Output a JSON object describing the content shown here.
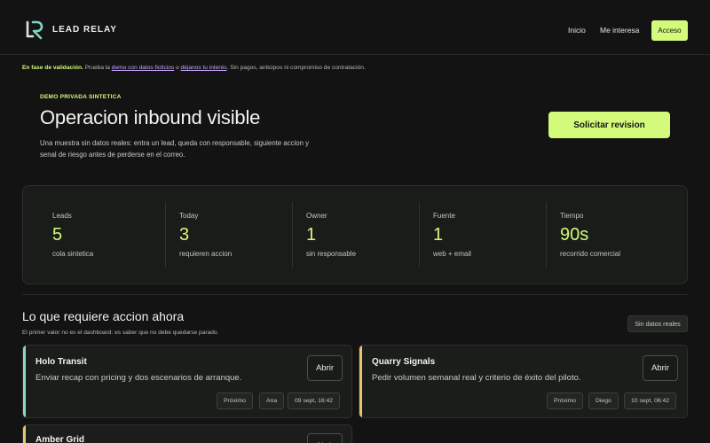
{
  "header": {
    "brand": "LEAD RELAY",
    "logo_icon": "lr-monogram-icon",
    "nav": [
      "Inicio",
      "Me interesa"
    ],
    "cta": "Acceso"
  },
  "notice": {
    "lead": "En fase de validación.",
    "t1": " Prueba la ",
    "link1": "demo con datos ficticios",
    "t2": " o ",
    "link2": "déjanos tu interés",
    "t3": ". Sin pagos, anticipos ni compromiso de contratación."
  },
  "hero": {
    "eyebrow": "DEMO PRIVADA SINTETICA",
    "title": "Operacion inbound visible",
    "description": "Una muestra sin datos reales: entra un lead, queda con responsable, siguiente accion y senal de riesgo antes de perderse en el correo.",
    "button": "Solicitar revision"
  },
  "stats": [
    {
      "label": "Leads",
      "value": "5",
      "sub": "cola sintetica"
    },
    {
      "label": "Today",
      "value": "3",
      "sub": "requieren accion"
    },
    {
      "label": "Owner",
      "value": "1",
      "sub": "sin responsable"
    },
    {
      "label": "Fuente",
      "value": "1",
      "sub": "web + email"
    },
    {
      "label": "Tiempo",
      "value": "90s",
      "sub": "recorrido comercial"
    }
  ],
  "section": {
    "title": "Lo que requiere accion ahora",
    "subtitle": "El primer valor no es el dashboard: es saber que no debe quedarse parado.",
    "badge": "Sin datos reales"
  },
  "cards": [
    {
      "name": "Holo Transit",
      "desc": "Enviar recap con pricing y dos escenarios de arranque.",
      "button": "Abrir",
      "tags": [
        "Próximo",
        "Ana",
        "09 sept, 16:42"
      ],
      "accent": "#8fd6c8"
    },
    {
      "name": "Quarry Signals",
      "desc": "Pedir volumen semanal real y criterio de éxito del piloto.",
      "button": "Abrir",
      "tags": [
        "Próximo",
        "Diego",
        "10 sept, 06:42"
      ],
      "accent": "#e8c56b"
    },
    {
      "name": "Amber Grid",
      "desc": "",
      "button": "Abrir",
      "tags": [],
      "accent": "#e8c56b"
    }
  ],
  "colors": {
    "accent": "#d3fa7a",
    "background": "#121312",
    "card": "#1b1d1b",
    "link": "#c7a6ff"
  }
}
